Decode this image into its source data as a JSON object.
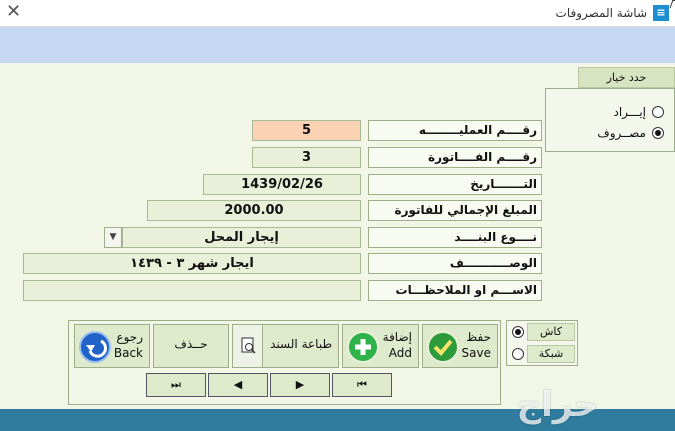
{
  "window": {
    "title": "شاشة المصروفات",
    "app_icon_glyph": "≡"
  },
  "type_group": {
    "legend": "حدد خيار",
    "options": [
      {
        "label": "إيـــراد",
        "checked": false
      },
      {
        "label": "مصــروف",
        "checked": true
      }
    ]
  },
  "fields": {
    "operation_no": {
      "label": "رقــــم العمليــــــــه",
      "value": "5"
    },
    "invoice_no": {
      "label": "رقــــم الفــــاتورة",
      "value": "3"
    },
    "date": {
      "label": "التـــــــاريخ",
      "value": "1439/02/26"
    },
    "total": {
      "label": "المبلغ الإجمالي للفاتورة",
      "value": "2000.00"
    },
    "item_type": {
      "label": "نــــوع البنــــد",
      "value": "إيجار المحل"
    },
    "description": {
      "label": "الوصـــــــــــف",
      "value": "ايجار شهر ٣ - ١٤٣٩"
    },
    "notes": {
      "label": "الاســـم او الملاحظـــات",
      "value": ""
    }
  },
  "buttons": {
    "save": {
      "line1": "حفظ",
      "line2": "Save"
    },
    "add": {
      "line1": "إضافة",
      "line2": "Add"
    },
    "print": {
      "label": "طباعة السند"
    },
    "delete": {
      "label": "حــذف"
    },
    "back": {
      "line1": "رجوع",
      "line2": "Back"
    }
  },
  "nav": {
    "first": "⏭",
    "prev": "◀",
    "next": "▶",
    "last": "⏮"
  },
  "payment": {
    "options": [
      {
        "label": "كاش",
        "checked": true
      },
      {
        "label": "شبكة",
        "checked": false
      }
    ]
  },
  "watermark": "حراج",
  "colors": {
    "accent_blue": "#c7d9f2",
    "footer": "#2f7c9e",
    "highlight": "#fbd2b4",
    "field_bg": "#e9f0d9"
  }
}
